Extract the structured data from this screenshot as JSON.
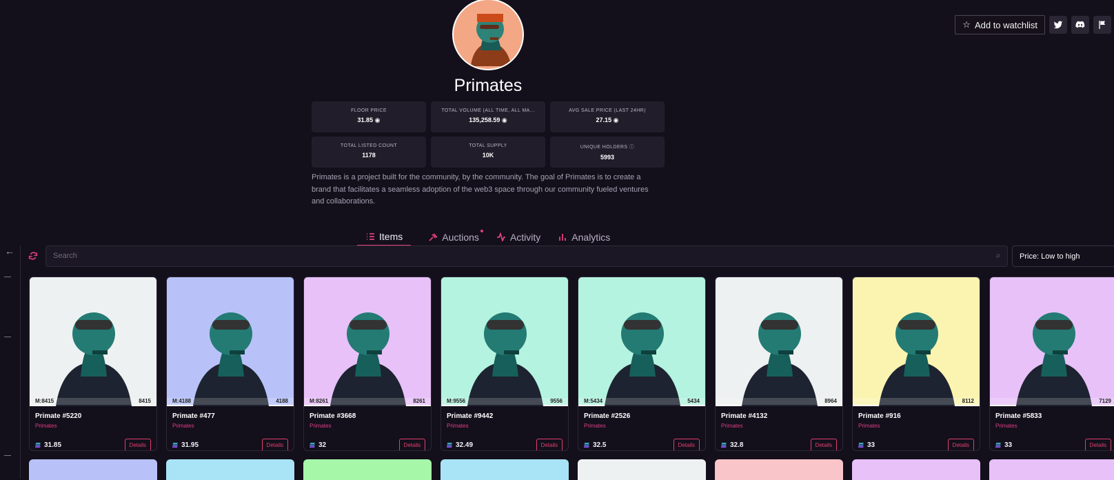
{
  "collection": {
    "name": "Primates",
    "watchlist_label": "Add to watchlist",
    "description": "Primates is a project built for the community, by the community. The goal of Primates is to create a brand that facilitates a seamless adoption of the web3 space through our community fueled ventures and collaborations."
  },
  "stats": [
    {
      "label": "FLOOR PRICE",
      "value": "31.85"
    },
    {
      "label": "TOTAL VOLUME (ALL TIME, ALL MA...",
      "value": "135,258.59"
    },
    {
      "label": "AVG SALE PRICE (LAST 24HR)",
      "value": "27.15"
    },
    {
      "label": "TOTAL LISTED COUNT",
      "value": "1178"
    },
    {
      "label": "TOTAL SUPPLY",
      "value": "10K"
    },
    {
      "label": "UNIQUE HOLDERS",
      "value": "5993"
    }
  ],
  "tabs": [
    {
      "label": "Items"
    },
    {
      "label": "Auctions"
    },
    {
      "label": "Activity"
    },
    {
      "label": "Analytics"
    }
  ],
  "search": {
    "placeholder": "Search"
  },
  "sort": {
    "label": "Price: Low to high"
  },
  "cards": [
    {
      "name": "Primate #5220",
      "collection": "Primates",
      "price": "31.85",
      "color": "#eef1f1",
      "left_tag": "M:8415",
      "right_tag": "8415",
      "details": "Details"
    },
    {
      "name": "Primate #477",
      "collection": "Primates",
      "price": "31.95",
      "color": "#b8c2f9",
      "left_tag": "M:4188",
      "right_tag": "4188",
      "details": "Details"
    },
    {
      "name": "Primate #3668",
      "collection": "Primates",
      "price": "32",
      "color": "#e8c1f8",
      "left_tag": "M:8261",
      "right_tag": "8261",
      "details": "Details"
    },
    {
      "name": "Primate #9442",
      "collection": "Primates",
      "price": "32.49",
      "color": "#b4f3df",
      "left_tag": "M:9556",
      "right_tag": "9556",
      "details": "Details"
    },
    {
      "name": "Primate #2526",
      "collection": "Primates",
      "price": "32.5",
      "color": "#b4f3df",
      "left_tag": "M:5434",
      "right_tag": "5434",
      "details": "Details"
    },
    {
      "name": "Primate #4132",
      "collection": "Primates",
      "price": "32.8",
      "color": "#eef1f1",
      "left_tag": "",
      "right_tag": "8964",
      "details": "Details"
    },
    {
      "name": "Primate #916",
      "collection": "Primates",
      "price": "33",
      "color": "#fbf4b0",
      "left_tag": "",
      "right_tag": "8112",
      "details": "Details"
    },
    {
      "name": "Primate #5833",
      "collection": "Primates",
      "price": "33",
      "color": "#e8c1f8",
      "left_tag": "",
      "right_tag": "7129",
      "details": "Details"
    }
  ],
  "second_row_colors": [
    "#b8c2f9",
    "#a8e4f5",
    "#a6f7a8",
    "#a8e4f5",
    "#eef1f1",
    "#f9c5c8",
    "#e8c1f8",
    "#e8c1f8"
  ],
  "colors": {
    "accent": "#e1407c",
    "background": "#130f1b"
  }
}
